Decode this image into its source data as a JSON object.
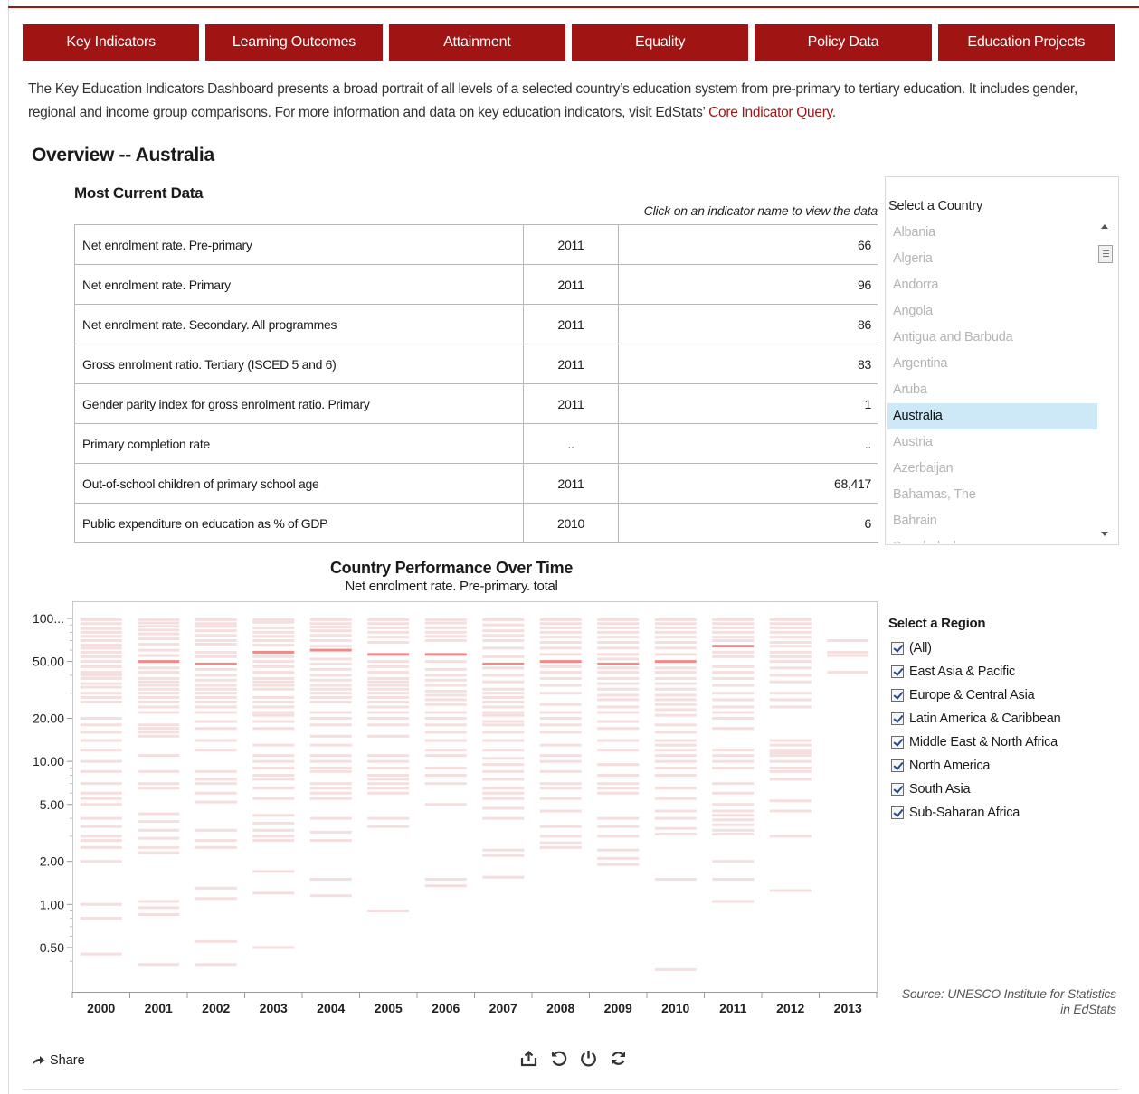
{
  "tabs": [
    "Key Indicators",
    "Learning Outcomes",
    "Attainment",
    "Equality",
    "Policy Data",
    "Education Projects"
  ],
  "intro": {
    "text": "The Key Education Indicators Dashboard presents a broad portrait of all levels of a selected country’s education system from pre-primary to tertiary education. It includes gender, regional and income group comparisons. For more information and data on key education indicators, visit EdStats’ ",
    "link": "Core Indicator Query",
    "tail": "."
  },
  "overview_title": "Overview -- Australia",
  "most_current": {
    "title": "Most Current Data",
    "hint": "Click on an indicator name to view the data",
    "rows": [
      {
        "name": "Net enrolment rate. Pre-primary",
        "year": "2011",
        "value": "66"
      },
      {
        "name": "Net enrolment rate. Primary",
        "year": "2011",
        "value": "96"
      },
      {
        "name": "Net enrolment rate. Secondary. All programmes",
        "year": "2011",
        "value": "86"
      },
      {
        "name": "Gross enrolment ratio. Tertiary (ISCED 5 and 6)",
        "year": "2011",
        "value": "83"
      },
      {
        "name": "Gender parity index for gross enrolment ratio. Primary",
        "year": "2011",
        "value": "1"
      },
      {
        "name": "Primary completion rate",
        "year": "..",
        "value": ".."
      },
      {
        "name": "Out-of-school children of primary school age",
        "year": "2011",
        "value": "68,417"
      },
      {
        "name": "Public expenditure on education as % of GDP",
        "year": "2010",
        "value": "6"
      }
    ]
  },
  "country_selector": {
    "label": "Select a Country",
    "selected": "Australia",
    "items": [
      "Albania",
      "Algeria",
      "Andorra",
      "Angola",
      "Antigua and Barbuda",
      "Argentina",
      "Aruba",
      "Australia",
      "Austria",
      "Azerbaijan",
      "Bahamas, The",
      "Bahrain",
      "Bangladesh"
    ]
  },
  "region_selector": {
    "title": "Select a Region",
    "items": [
      "(All)",
      "East Asia & Pacific",
      "Europe & Central Asia",
      "Latin America & Caribbean",
      "Middle East & North Africa",
      "North America",
      "South Asia",
      "Sub-Saharan Africa"
    ]
  },
  "source": {
    "line1": "Source: UNESCO Institute for Statistics",
    "line2": "in EdStats"
  },
  "share_label": "Share",
  "icons": [
    "share-icon",
    "export-icon",
    "revert-icon",
    "power-icon",
    "refresh-icon"
  ],
  "colors": {
    "accent": "#a01414",
    "band": "#f5dede",
    "band_line": "#ffffff",
    "highlight": "#f08a8a",
    "selected_row": "#cde8f6"
  },
  "chart_data": {
    "type": "scatter",
    "title": "Country Performance Over Time",
    "subtitle": "Net enrolment rate. Pre-primary. total",
    "y_scale": "log",
    "ylim": [
      0.3,
      100
    ],
    "y_ticks": [
      {
        "v": 100,
        "label": "100..."
      },
      {
        "v": 50,
        "label": "50.00"
      },
      {
        "v": 20,
        "label": "20.00"
      },
      {
        "v": 10,
        "label": "10.00"
      },
      {
        "v": 5,
        "label": "5.00"
      },
      {
        "v": 2,
        "label": "2.00"
      },
      {
        "v": 1,
        "label": "1.00"
      },
      {
        "v": 0.5,
        "label": "0.50"
      }
    ],
    "categories": [
      "2000",
      "2001",
      "2002",
      "2003",
      "2004",
      "2005",
      "2006",
      "2007",
      "2008",
      "2009",
      "2010",
      "2011",
      "2012",
      "2013"
    ],
    "highlight_series": {
      "name": "Australia",
      "values": [
        null,
        50,
        48,
        58,
        60,
        56,
        56,
        48,
        50,
        48,
        50,
        64,
        null,
        null
      ]
    },
    "countries_values": [
      [
        98,
        92,
        85,
        80,
        75,
        70,
        65,
        62,
        58,
        54,
        50,
        46,
        42,
        40,
        38,
        35,
        33,
        30,
        28,
        26,
        20,
        18,
        16,
        14,
        12,
        10,
        8.5,
        7,
        6,
        5.5,
        5,
        4,
        3.5,
        3,
        2.8,
        2.5,
        2,
        1,
        0.8,
        0.45
      ],
      [
        98,
        93,
        88,
        83,
        78,
        72,
        66,
        60,
        55,
        45,
        42,
        38,
        36,
        34,
        32,
        30,
        28,
        26,
        24,
        22,
        18,
        17,
        16,
        15,
        11,
        8.5,
        7,
        6.5,
        4.3,
        3.8,
        3.3,
        2.9,
        2.5,
        2.3,
        1.05,
        0.95,
        0.85,
        0.38
      ],
      [
        98,
        92,
        88,
        82,
        76,
        70,
        66,
        58,
        54,
        44,
        40,
        37,
        34,
        32,
        30,
        28,
        26,
        24,
        22,
        19,
        17,
        14,
        12,
        8.5,
        7.5,
        7,
        6,
        5.2,
        3.3,
        2.8,
        2.5,
        1.3,
        1.1,
        0.55,
        0.38
      ],
      [
        98,
        94,
        86,
        80,
        75,
        70,
        65,
        54,
        50,
        46,
        42,
        38,
        36,
        34,
        32,
        28,
        26,
        24,
        22,
        21,
        19,
        17,
        13,
        11,
        10,
        9,
        8,
        7.5,
        6.5,
        5.5,
        4.2,
        3.7,
        3.3,
        3,
        2.8,
        1.7,
        1.2,
        0.5
      ],
      [
        98,
        92,
        87,
        82,
        76,
        70,
        64,
        52,
        48,
        44,
        40,
        37,
        34,
        32,
        30,
        28,
        26,
        22,
        20,
        18,
        15,
        13,
        11,
        10,
        9,
        8.5,
        7,
        6.5,
        6,
        5.5,
        4,
        3.2,
        2.8,
        1.5,
        1.15
      ],
      [
        98,
        92,
        86,
        80,
        74,
        68,
        50,
        46,
        42,
        38,
        36,
        34,
        32,
        30,
        28,
        26,
        24,
        22,
        20,
        18,
        15,
        11,
        10,
        9,
        8,
        7.5,
        7,
        6.5,
        6,
        4,
        3.5,
        0.9
      ],
      [
        98,
        93,
        86,
        80,
        75,
        70,
        50,
        44,
        40,
        37,
        34,
        31,
        29,
        27,
        25,
        22,
        20,
        18,
        16,
        14,
        12,
        11,
        9,
        8,
        7,
        5,
        1.5,
        1.35
      ],
      [
        98,
        90,
        82,
        76,
        70,
        62,
        54,
        45,
        40,
        36,
        32,
        30,
        28,
        26,
        24,
        22,
        21,
        19,
        18,
        16,
        14,
        12,
        10.5,
        9.5,
        8.5,
        7.5,
        6.5,
        6,
        5.5,
        4.7,
        4,
        2.4,
        2.2,
        1.55
      ],
      [
        98,
        92,
        86,
        80,
        74,
        68,
        62,
        56,
        46,
        42,
        38,
        34,
        30,
        25,
        22,
        20,
        18,
        16,
        13,
        11,
        10,
        8.5,
        7,
        6.5,
        5.5,
        4.5,
        3.5,
        3,
        2.7,
        2.5
      ],
      [
        98,
        92,
        86,
        80,
        74,
        68,
        62,
        56,
        52,
        45,
        42,
        38,
        35,
        32,
        29,
        27,
        24,
        22,
        19,
        17,
        14,
        12,
        9.5,
        8,
        7,
        6.5,
        6,
        4,
        3.5,
        3,
        2.4,
        2.1,
        1.9
      ],
      [
        98,
        92,
        86,
        80,
        74,
        68,
        62,
        56,
        45,
        42,
        38,
        35,
        32,
        29,
        27,
        25,
        23,
        21,
        18,
        16,
        14,
        13,
        12,
        11,
        10,
        9,
        8,
        6.5,
        5.5,
        4.5,
        4,
        3.4,
        3.1,
        1.5,
        0.35
      ],
      [
        98,
        92,
        86,
        80,
        74,
        70,
        58,
        54,
        46,
        42,
        38,
        34,
        30,
        27,
        24,
        22,
        20,
        17,
        12,
        11,
        10,
        9,
        7,
        6,
        5,
        4.5,
        4.2,
        3.9,
        3.6,
        3.3,
        3.1,
        2,
        1.5,
        1.05
      ],
      [
        98,
        92,
        86,
        80,
        74,
        68,
        64,
        58,
        54,
        50,
        45,
        40,
        36,
        30,
        27,
        24,
        14,
        13,
        12,
        11.5,
        11,
        10,
        9,
        8.5,
        7.5,
        5.3,
        4.5,
        3,
        1.25
      ],
      [
        70,
        58,
        55,
        42
      ]
    ]
  }
}
